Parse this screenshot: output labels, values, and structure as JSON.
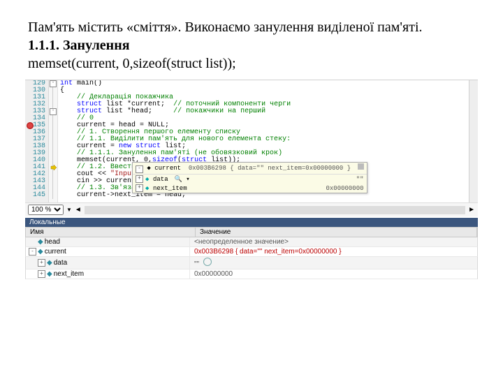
{
  "doc": {
    "p1": "Пам'ять містить «сміття». Виконаємо занулення виділеної пам'яті.",
    "h1": "1.1.1. Занулення",
    "p2": "memset(current, 0,sizeof(struct list));"
  },
  "zoom": {
    "level": "100 %"
  },
  "code": {
    "lines": [
      {
        "n": "129",
        "pre": "int",
        "rest": " main()"
      },
      {
        "n": "130",
        "plain": "{"
      },
      {
        "n": "131",
        "indent": "    ",
        "cm": "// Декларація покажчика"
      },
      {
        "n": "132",
        "indent": "    ",
        "kw": "struct",
        "mid": " list *current;  ",
        "cm": "// поточний компоненти черги"
      },
      {
        "n": "133",
        "indent": "    ",
        "kw": "struct",
        "mid": " list *head;     ",
        "cm": "// покажчики на перший"
      },
      {
        "n": "134",
        "indent": "    ",
        "cm": "// 0",
        "bp": true
      },
      {
        "n": "135",
        "indent": "    ",
        "plain": "current = head = NULL;"
      },
      {
        "n": "136",
        "indent": "    ",
        "cm": "// 1. Створення першого елементу списку"
      },
      {
        "n": "137",
        "indent": "    ",
        "cm": "// 1.1. Виділити пам'ять для нового елемента стеку:"
      },
      {
        "n": "138",
        "indent": "    ",
        "plain": "current = ",
        "kw": "new",
        "mid": " ",
        "kw2": "struct",
        "rest": " list;"
      },
      {
        "n": "139",
        "indent": "    ",
        "cm": "// 1.1.1. Занулення пам'яті (не обовязковий крок)"
      },
      {
        "n": "140",
        "indent": "    ",
        "plain": "memset(current, 0,",
        "kw": "sizeof",
        "mid": "(",
        "kw2": "struct",
        "rest": " list));"
      },
      {
        "n": "141",
        "indent": "    ",
        "cm": "// 1.2. Ввести дані:",
        "arrow": true
      },
      {
        "n": "142",
        "indent": "    ",
        "plain": "cout << ",
        "str": "\"Input \""
      },
      {
        "n": "143",
        "indent": "    ",
        "plain": "cin >> current->data;"
      },
      {
        "n": "144",
        "indent": "    ",
        "cm": "// 1.3. Зв'язати допоміжний елемент із вершиною"
      },
      {
        "n": "145",
        "indent": "    ",
        "plain": "current->next_item = head;"
      }
    ]
  },
  "tooltip": {
    "head_name": "current",
    "head_val": "0x003B6298 { data=\"\" next_item=0x00000000 }",
    "rows": [
      {
        "exp": "+",
        "icon": "dot",
        "name": "data",
        "extra_icon": true,
        "val": "\"\""
      },
      {
        "exp": "+",
        "icon": "dot",
        "name": "next_item",
        "val": "0x00000000"
      }
    ]
  },
  "locals": {
    "title": "Локальные",
    "col_name": "Имя",
    "col_value": "Значение",
    "rows": [
      {
        "depth": 0,
        "exp": "",
        "icon": "dot",
        "name": "head",
        "value": "<неопределенное значение>",
        "red": false
      },
      {
        "depth": 0,
        "exp": "-",
        "icon": "dot",
        "name": "current",
        "value": "0x003B6298 { data=\"\" next_item=0x00000000 }",
        "red": true
      },
      {
        "depth": 1,
        "exp": "+",
        "icon": "dot",
        "name": "data",
        "value": "\"\"",
        "red": false,
        "refresh": true
      },
      {
        "depth": 1,
        "exp": "+",
        "icon": "dot",
        "name": "next_item",
        "value": "0x00000000",
        "red": false
      }
    ]
  }
}
